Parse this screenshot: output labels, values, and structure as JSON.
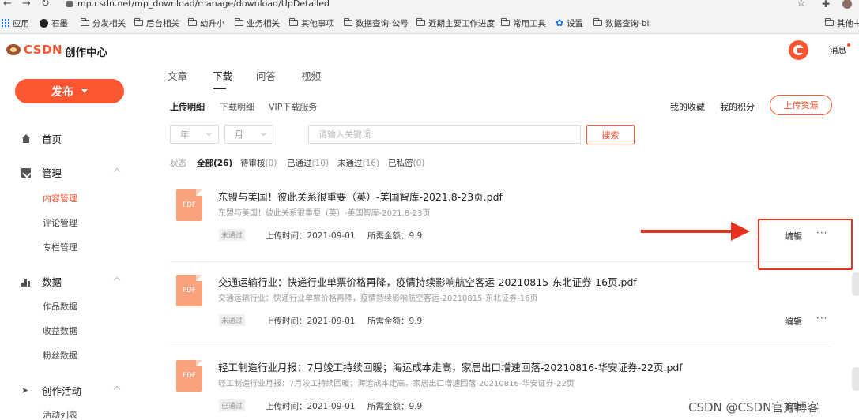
{
  "browser": {
    "url": "mp.csdn.net/mp_download/manage/download/UpDetailed",
    "bookmarks": [
      "应用",
      "石墨",
      "分发相关",
      "后台相关",
      "幼升小",
      "业务相关",
      "其他事项",
      "数据查询-公号",
      "近期主要工作进度",
      "常用工具",
      "设置",
      "数据查询-bi",
      "其他书"
    ]
  },
  "header": {
    "logo": "CSDN",
    "subtitle": "创作中心",
    "message_label": "消息"
  },
  "sidebar": {
    "publish_label": "发布",
    "home": "首页",
    "manage": "管理",
    "manage_items": [
      "内容管理",
      "评论管理",
      "专栏管理"
    ],
    "data": "数据",
    "data_items": [
      "作品数据",
      "收益数据",
      "粉丝数据"
    ],
    "activity": "创作活动",
    "activity_items": [
      "活动列表"
    ]
  },
  "main": {
    "tabs": [
      "文章",
      "下载",
      "问答",
      "视频"
    ],
    "subtabs": [
      "上传明细",
      "下载明细",
      "VIP下载服务"
    ],
    "links": [
      "我的收藏",
      "我的积分"
    ],
    "upload_button": "上传资源",
    "year_placeholder": "年",
    "month_placeholder": "月",
    "search_placeholder": "请输入关键词",
    "search_button": "搜索",
    "status_label": "状态",
    "filters": [
      {
        "label": "全部",
        "count": "(26)"
      },
      {
        "label": "待审核",
        "count": "(0)"
      },
      {
        "label": "已通过",
        "count": "(10)"
      },
      {
        "label": "未通过",
        "count": "(16)"
      },
      {
        "label": "已私密",
        "count": "(0)"
      }
    ],
    "items": [
      {
        "icon_label": "PDF",
        "title": "东盟与美国！彼此关系很重要（英）-美国智库-2021.8-23页.pdf",
        "desc": "东盟与美国！彼此关系很重要（英）-美国智库-2021.8-23页",
        "status": "未通过",
        "upload_time": "上传时间：2021-09-01",
        "price": "所需金额：9.9",
        "edit": "编辑",
        "more": "···"
      },
      {
        "icon_label": "PDF",
        "title": "交通运输行业：快递行业单票价格再降，疫情持续影响航空客运-20210815-东北证券-16页.pdf",
        "desc": "交通运输行业：快递行业单票价格再降，疫情持续影响航空客运-20210815-东北证券-16页",
        "status": "未通过",
        "upload_time": "上传时间：2021-09-01",
        "price": "所需金额：9.9",
        "edit": "编辑",
        "more": "···"
      },
      {
        "icon_label": "PDF",
        "title": "轻工制造行业月报：7月竣工持续回暖；海运成本走高，家居出口增速回落-20210816-华安证券-22页.pdf",
        "desc": "轻工制造行业月报：7月竣工持续回暖；海运成本走高，家居出口增速回落-20210816-华安证券-22页",
        "status": "已通过",
        "upload_time": "上传时间：2021-09-01",
        "price": "所需金额：9.9",
        "edit": "编辑",
        "more": ""
      }
    ]
  },
  "watermark": "CSDN @CSDN官方博客",
  "colors": {
    "accent": "#fc5531",
    "annotation_red": "#e8311d"
  }
}
